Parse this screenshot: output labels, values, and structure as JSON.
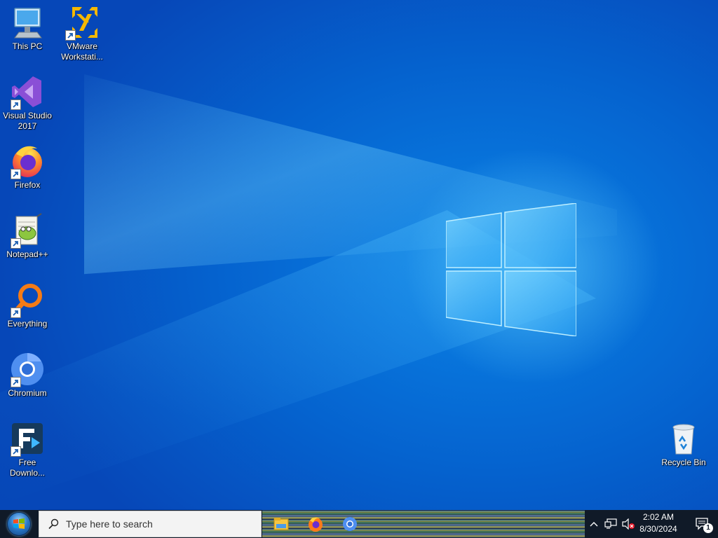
{
  "desktop": {
    "icons": [
      {
        "id": "this-pc",
        "label": "This PC",
        "icon": "computer-icon"
      },
      {
        "id": "vmware",
        "label": "VMware\nWorkstati...",
        "icon": "vmware-icon"
      },
      {
        "id": "visual-studio",
        "label": "Visual Studio\n2017",
        "icon": "visual-studio-icon"
      },
      {
        "id": "firefox",
        "label": "Firefox",
        "icon": "firefox-icon"
      },
      {
        "id": "notepadpp",
        "label": "Notepad++",
        "icon": "notepadpp-icon"
      },
      {
        "id": "everything",
        "label": "Everything",
        "icon": "everything-icon"
      },
      {
        "id": "chromium",
        "label": "Chromium",
        "icon": "chromium-icon"
      },
      {
        "id": "fdm",
        "label": "Free\nDownlo...",
        "icon": "free-download-manager-icon"
      },
      {
        "id": "recycle-bin",
        "label": "Recycle Bin",
        "icon": "recycle-bin-icon"
      }
    ]
  },
  "taskbar": {
    "search_placeholder": "Type here to search",
    "pinned_apps": [
      "file-explorer-icon",
      "firefox-icon",
      "chromium-icon"
    ],
    "clock": {
      "time": "2:02 AM",
      "date": "8/30/2024"
    },
    "notifications_count": "1"
  },
  "colors": {
    "wallpaper_blue": "#0a83e6",
    "taskbar_bg": "#101a28"
  }
}
